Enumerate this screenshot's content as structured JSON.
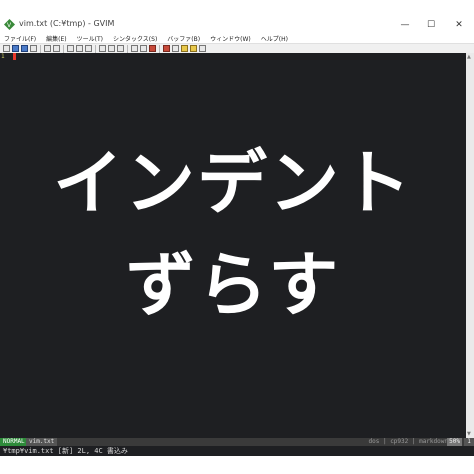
{
  "window": {
    "title": "vim.txt (C:¥tmp) - GVIM",
    "minimize_glyph": "—",
    "maximize_glyph": "☐",
    "close_glyph": "✕",
    "icon": "vim-app-icon"
  },
  "menu": [
    "ファイル(F)",
    "編集(E)",
    "ツール(T)",
    "シンタックス(S)",
    "バッファ(B)",
    "ウィンドウ(W)",
    "ヘルプ(H)"
  ],
  "toolbar_icons": [
    "open-icon",
    "save-icon",
    "save-all-icon",
    "print-icon",
    "undo-icon",
    "redo-icon",
    "cut-icon",
    "copy-icon",
    "paste-icon",
    "find-icon",
    "find-next-icon",
    "find-prev-icon",
    "load-session-icon",
    "save-session-icon",
    "run-script-icon",
    "make-icon",
    "shell-icon",
    "tag-icon",
    "help-icon",
    "find-help-icon"
  ],
  "editor": {
    "line_number": "1",
    "text_line1": "インデント",
    "text_line2": "ずらす",
    "colors": {
      "background": "#1e1f22",
      "text": "#ffffff",
      "cursor": "#e8372c"
    }
  },
  "status": {
    "mode": "NORMAL",
    "filename": "vim.txt",
    "right_info": "dos | cp932 | markdown",
    "percent": "50%",
    "position": "1"
  },
  "cmdline": "¥tmp¥vim.txt [新] 2L, 4C 書込み"
}
